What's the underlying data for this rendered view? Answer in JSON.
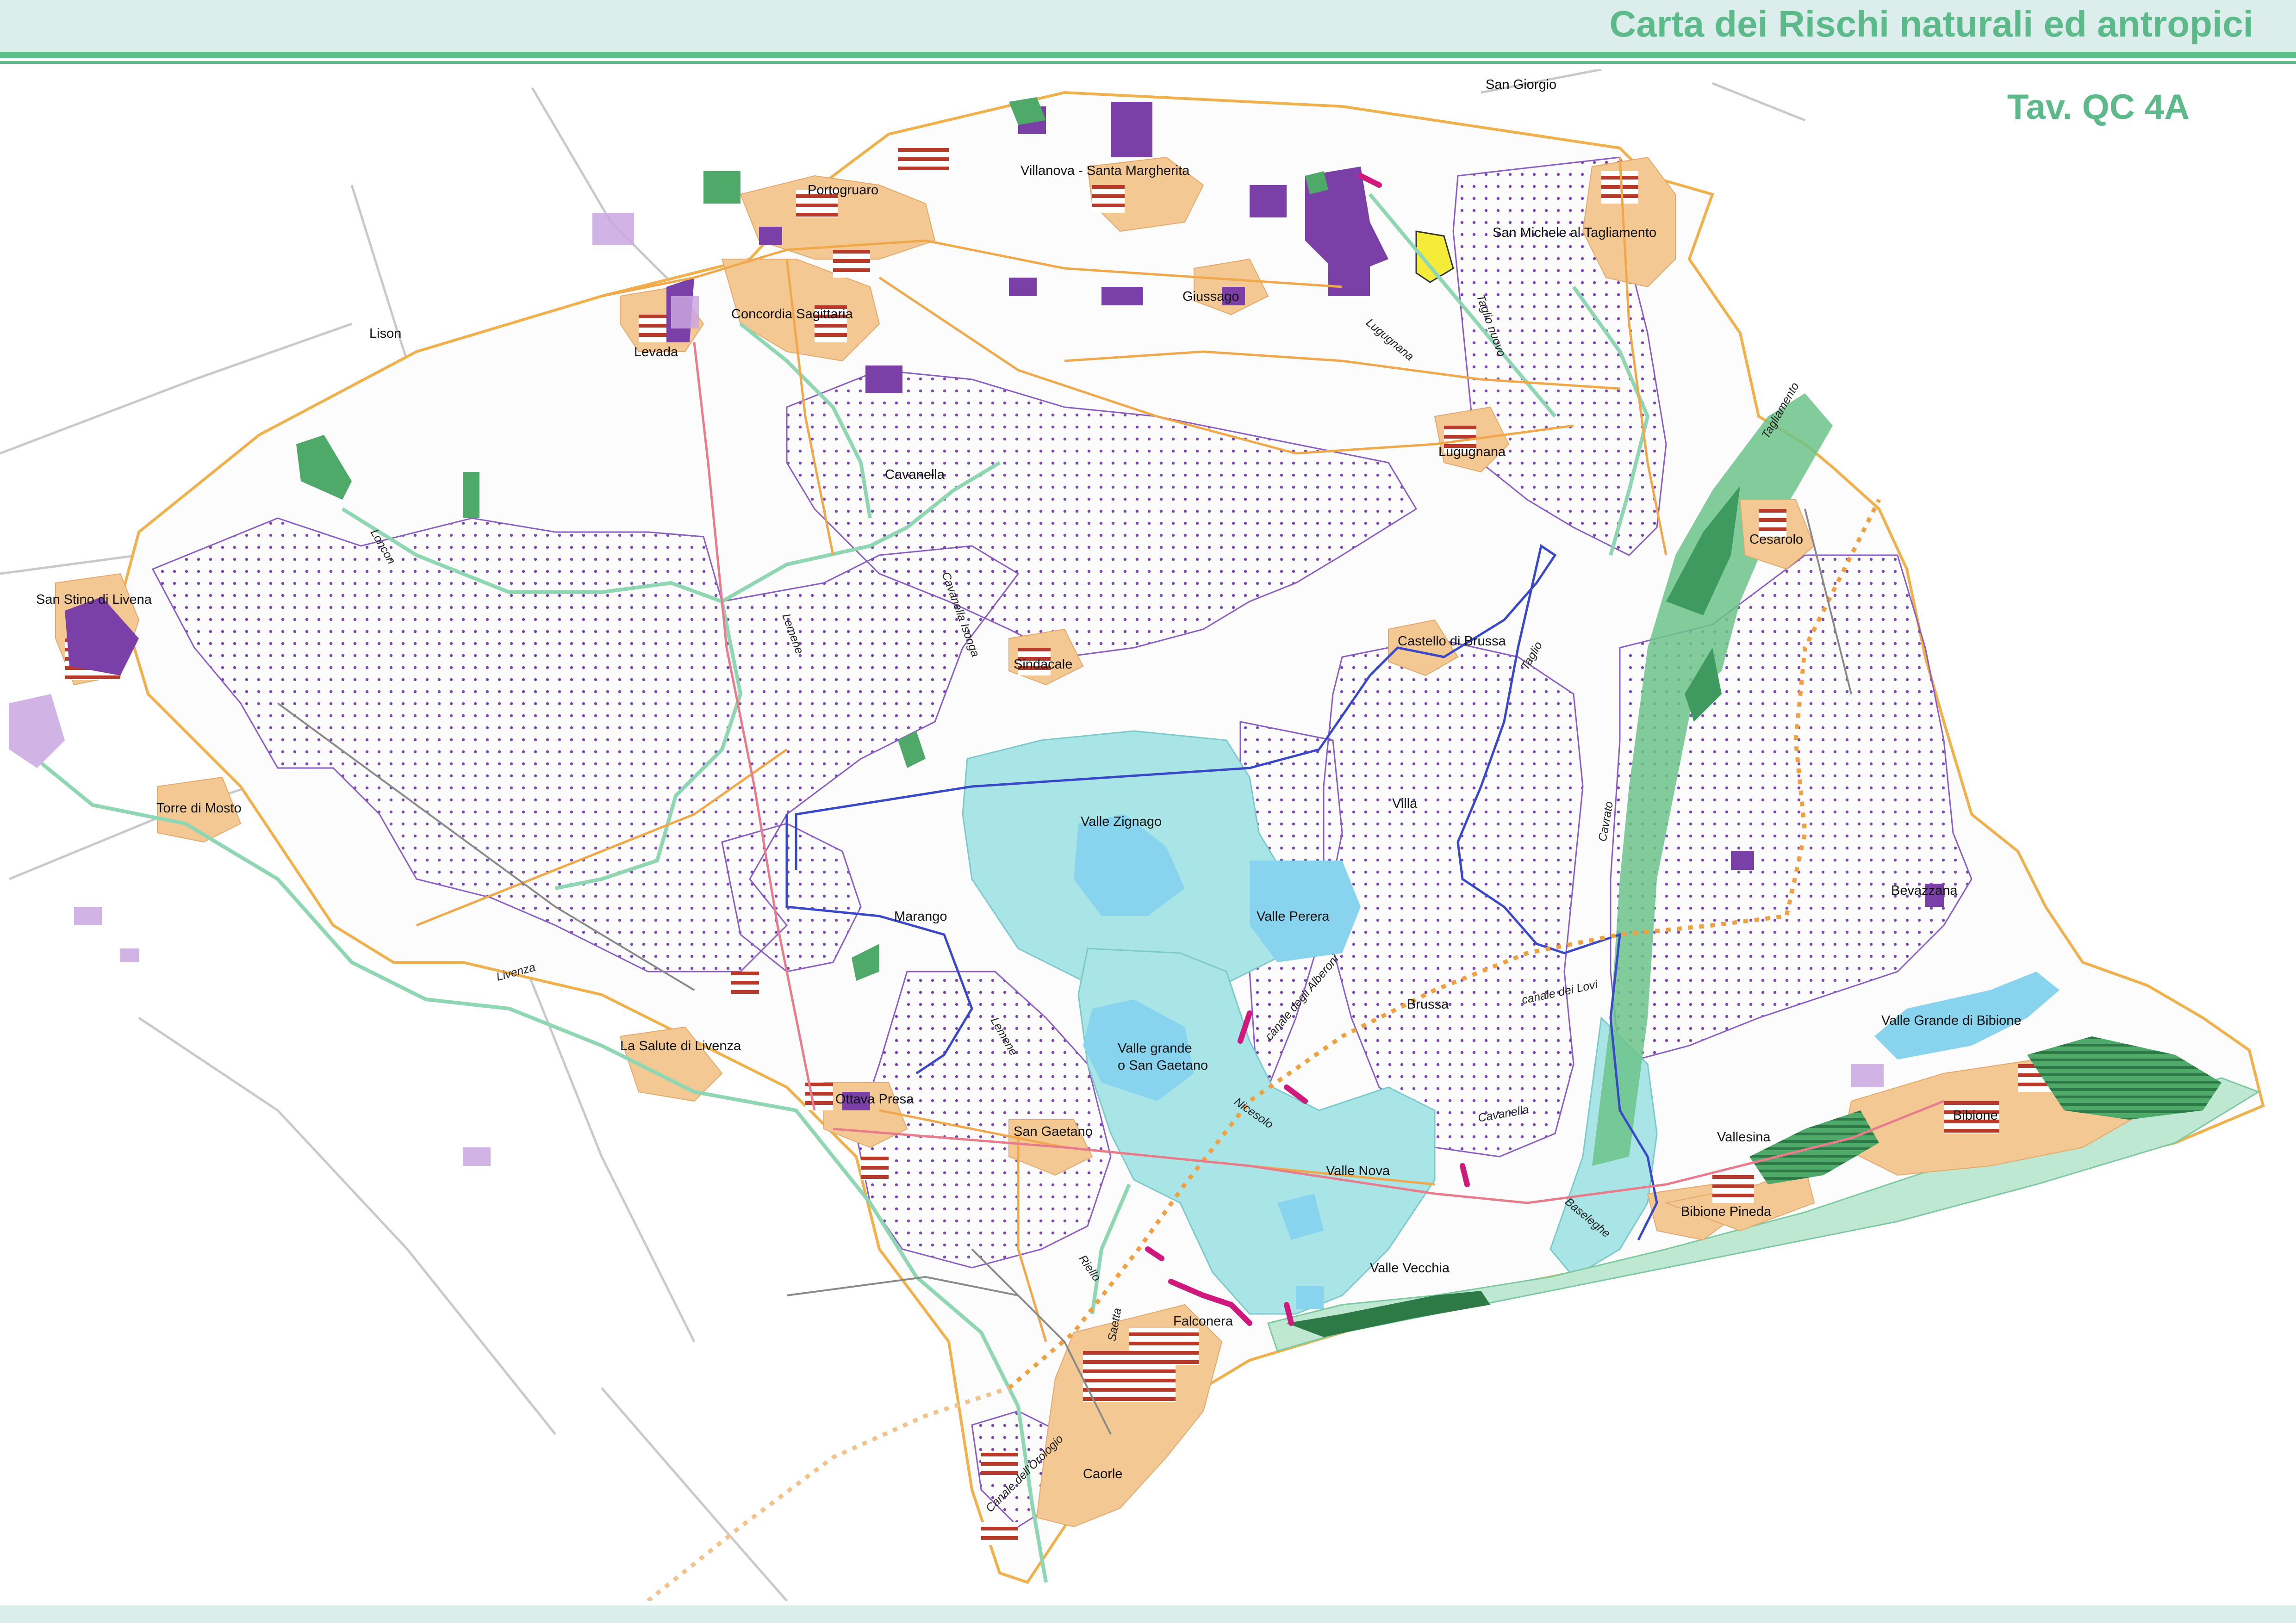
{
  "header": {
    "title": "Carta dei Rischi naturali ed antropici",
    "sheet_code": "Tav. QC 4A"
  },
  "colors": {
    "header_band": "#dbeeeb",
    "header_rule": "#5cbf8a",
    "title_text": "#5cb98a",
    "lagoon": "#a9e4e6",
    "valley_water": "#88d4ee",
    "flood_area_dots": "#7a45b5",
    "flood_area_outline": "#8a5cc4",
    "urban": "#f3c893",
    "hazard_purple": "#7b3fa8",
    "hazard_stripes": "#b83a2a",
    "green_area": "#4faa6a",
    "dark_green": "#2e7a47",
    "pipeline": "#f0a040",
    "river_line": "#8fd6b3",
    "boundary": "#f0b04b"
  },
  "map": {
    "towns": [
      "San Giorgio",
      "Portogruaro",
      "Villanova - Santa Margherita",
      "San Michele al Tagliamento",
      "Concordia Sagittaria",
      "Giussago",
      "Lison",
      "Levada",
      "Cavanella",
      "Lugugnana",
      "San Stino di Livena",
      "Cesarolo",
      "Castello di Brussa",
      "Sindacale",
      "Torre di Mosto",
      "Villa",
      "Bevazzana",
      "Marango",
      "Brussa",
      "La Salute di Livenza",
      "Ottava Presa",
      "San Gaetano",
      "Vallesina",
      "Bibione",
      "Bibione Pineda",
      "Falconera",
      "Caorle"
    ],
    "water_bodies": [
      "Valle Zignago",
      "Valle Perera",
      "Valle grande",
      "o San Gaetano",
      "Valle Nova",
      "Valle Vecchia",
      "Valle Grande di Bibione"
    ],
    "waterways": [
      "Loncon",
      "Lemene",
      "Cavanella Isonga",
      "Livenza",
      "Lugugnana",
      "Taglio nuovo",
      "Tagliamento",
      "Taglio",
      "Cavrato",
      "canale dei Lovi",
      "canale degli Alberoni",
      "Nicesolo",
      "Cavanella",
      "Baseleghe",
      "Riello",
      "Saetta",
      "Canale dell'Orologio",
      "Lemene"
    ]
  }
}
